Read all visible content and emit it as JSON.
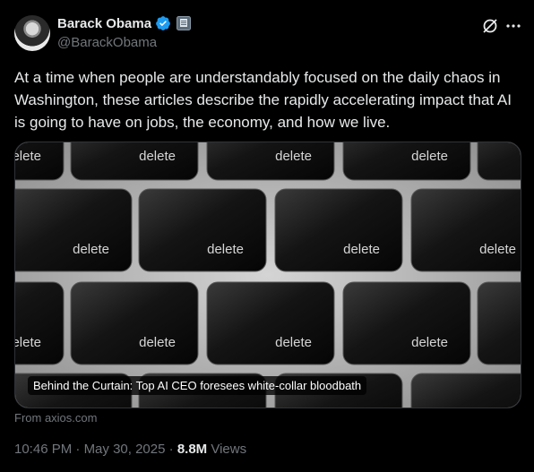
{
  "author": {
    "name": "Barack Obama",
    "handle": "@BarackObama",
    "verified_icon": "verified-badge-icon",
    "gov_icon": "government-seal-icon"
  },
  "header_icons": [
    "grok-icon",
    "more-icon"
  ],
  "tweet": {
    "text": "At a time when people are understandably focused on the daily chaos in Washington, these articles describe the rapidly accelerating impact that AI is going to have on jobs, the economy, and how we live."
  },
  "card": {
    "key_label": "delete",
    "headline": "Behind the Curtain: Top AI CEO foresees white-collar bloodbath",
    "source": "From axios.com"
  },
  "meta": {
    "time": "10:46 PM",
    "separator": " · ",
    "date": "May 30, 2025",
    "views_count": "8.8M",
    "views_label": " Views"
  },
  "colors": {
    "background": "#000000",
    "text": "#e7e9ea",
    "muted": "#71767b",
    "verified_blue": "#1d9bf0",
    "border": "#2f3336"
  }
}
